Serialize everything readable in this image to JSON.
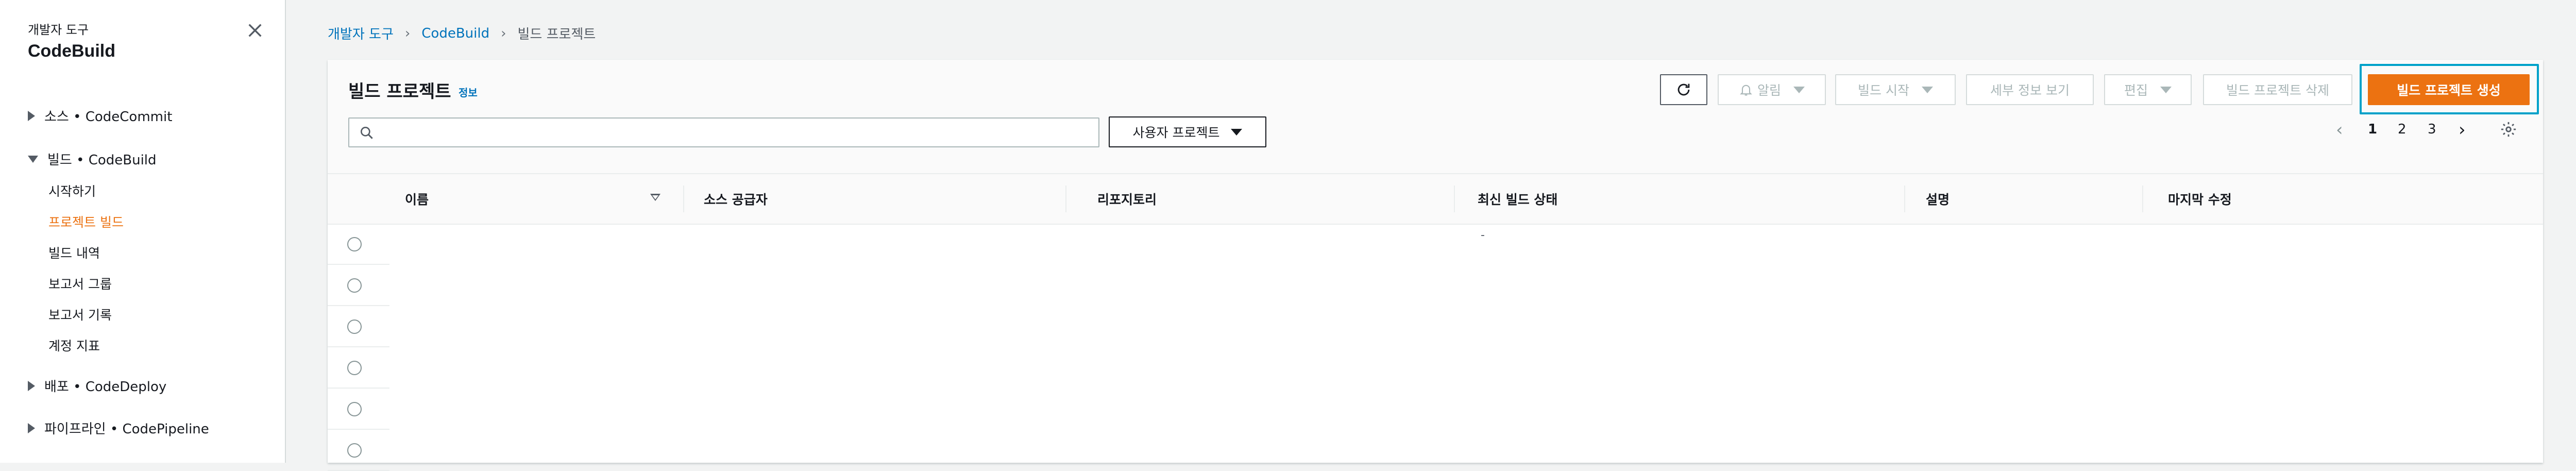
{
  "sidebar": {
    "subtitle": "개발자 도구",
    "title": "CodeBuild",
    "groups": [
      {
        "label": "소스 • CodeCommit",
        "expanded": false
      },
      {
        "label": "빌드 • CodeBuild",
        "expanded": true
      },
      {
        "label": "배포 • CodeDeploy",
        "expanded": false
      },
      {
        "label": "파이프라인 • CodePipeline",
        "expanded": false
      }
    ],
    "build_items": [
      "시작하기",
      "프로젝트 빌드",
      "빌드 내역",
      "보고서 그룹",
      "보고서 기록",
      "계정 지표"
    ],
    "active_item": "프로젝트 빌드"
  },
  "breadcrumb": [
    "개발자 도구",
    "CodeBuild",
    "빌드 프로젝트"
  ],
  "panel": {
    "title": "빌드 프로젝트",
    "info": "정보",
    "buttons": {
      "notify": "알림",
      "start_build": "빌드 시작",
      "view_details": "세부 정보 보기",
      "edit": "편집",
      "delete": "빌드 프로젝트 삭제",
      "create": "빌드 프로젝트 생성"
    },
    "search": {
      "placeholder": "",
      "value": ""
    },
    "filter_select": "사용자 프로젝트",
    "pagination": {
      "pages": [
        "1",
        "2",
        "3"
      ],
      "current": "1"
    }
  },
  "table": {
    "columns": [
      "이름",
      "소스 공급자",
      "리포지토리",
      "최신 빌드 상태",
      "설명",
      "마지막 수정"
    ],
    "rows": [
      {
        "name": "",
        "source": "",
        "repo": "",
        "status": "-",
        "desc": "",
        "modified": ""
      },
      {
        "name": "",
        "source": "",
        "repo": "",
        "status": "",
        "desc": "",
        "modified": ""
      },
      {
        "name": "",
        "source": "",
        "repo": "",
        "status": "",
        "desc": "",
        "modified": ""
      },
      {
        "name": "",
        "source": "",
        "repo": "",
        "status": "",
        "desc": "",
        "modified": ""
      },
      {
        "name": "",
        "source": "",
        "repo": "",
        "status": "",
        "desc": "",
        "modified": ""
      },
      {
        "name": "",
        "source": "",
        "repo": "",
        "status": "",
        "desc": "",
        "modified": ""
      }
    ]
  },
  "colors": {
    "accent": "#ec7211",
    "link": "#0073bb",
    "focus": "#00a1c9"
  },
  "icons": [
    "close-icon",
    "refresh-icon",
    "bell-icon",
    "search-icon",
    "chevron-left-icon",
    "chevron-right-icon",
    "settings-icon"
  ]
}
